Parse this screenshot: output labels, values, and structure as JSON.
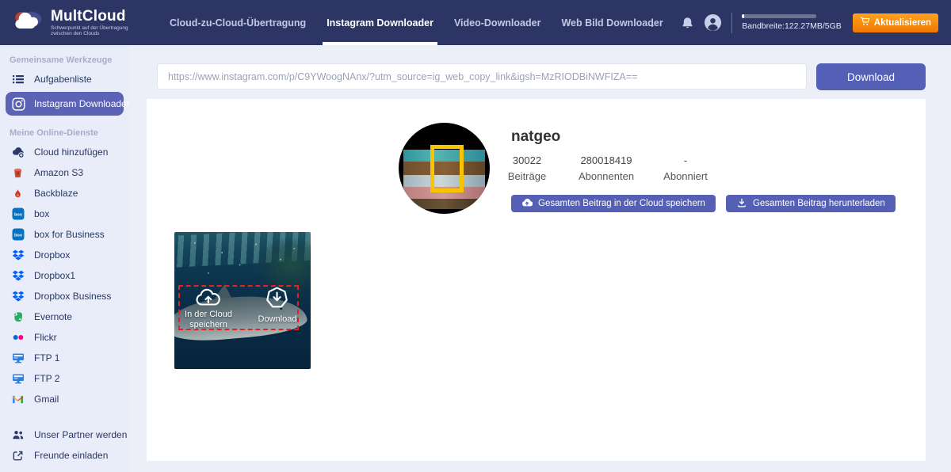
{
  "navbar": {
    "logo": {
      "title": "MultCloud",
      "tagline": "Schwerpunkt auf der Übertragung zwischen den Clouds"
    },
    "tabs": [
      {
        "label": "Cloud-zu-Cloud-Übertragung",
        "active": false
      },
      {
        "label": "Instagram Downloader",
        "active": true
      },
      {
        "label": "Video-Downloader",
        "active": false
      },
      {
        "label": "Web Bild Downloader",
        "active": false
      }
    ],
    "bandwidth": {
      "label": "Bandbreite:122.27MB/5GB",
      "percent": 3
    },
    "upgrade_button": "Aktualisieren"
  },
  "sidebar": {
    "sections": [
      {
        "label": "Gemeinsame Werkzeuge",
        "items": [
          {
            "label": "Aufgabenliste",
            "icon": "task-list-icon",
            "active": false
          },
          {
            "label": "Instagram Downloader",
            "icon": "instagram-icon",
            "active": true
          }
        ]
      },
      {
        "label": "Meine Online-Dienste",
        "items": [
          {
            "label": "Cloud hinzufügen",
            "icon": "add-cloud-icon",
            "active": false
          },
          {
            "label": "Amazon S3",
            "icon": "amazon-s3-icon",
            "active": false
          },
          {
            "label": "Backblaze",
            "icon": "backblaze-icon",
            "active": false
          },
          {
            "label": "box",
            "icon": "box-icon",
            "active": false
          },
          {
            "label": "box for Business",
            "icon": "box-icon",
            "active": false
          },
          {
            "label": "Dropbox",
            "icon": "dropbox-icon",
            "active": false
          },
          {
            "label": "Dropbox1",
            "icon": "dropbox-icon",
            "active": false
          },
          {
            "label": "Dropbox Business",
            "icon": "dropbox-icon",
            "active": false
          },
          {
            "label": "Evernote",
            "icon": "evernote-icon",
            "active": false
          },
          {
            "label": "Flickr",
            "icon": "flickr-icon",
            "active": false
          },
          {
            "label": "FTP 1",
            "icon": "ftp-icon",
            "active": false
          },
          {
            "label": "FTP 2",
            "icon": "ftp-icon",
            "active": false
          },
          {
            "label": "Gmail",
            "icon": "gmail-icon",
            "active": false
          }
        ]
      }
    ],
    "footer_items": [
      {
        "label": "Unser Partner werden",
        "icon": "partner-icon",
        "active": false
      },
      {
        "label": "Freunde einladen",
        "icon": "invite-icon",
        "active": false
      }
    ]
  },
  "downloader": {
    "url_value": "https://www.instagram.com/p/C9YWoogNAnx/?utm_source=ig_web_copy_link&igsh=MzRIODBiNWFIZA==",
    "download_button": "Download"
  },
  "profile": {
    "username": "natgeo",
    "stats": [
      {
        "value": "30022",
        "label": "Beiträge"
      },
      {
        "value": "280018419",
        "label": "Abonnenten"
      },
      {
        "value": "-",
        "label": "Abonniert"
      }
    ],
    "save_all_button": "Gesamten Beitrag in der Cloud speichern",
    "download_all_button": "Gesamten Beitrag herunterladen"
  },
  "post": {
    "save_label": "In der Cloud speichern",
    "download_label": "Download"
  },
  "colors": {
    "navbar_bg": "#2d3565",
    "sidebar_bg": "#e9edf9",
    "accent_purple": "#5a63b5",
    "button_purple": "#5560b4",
    "upgrade_orange": "#f07800",
    "selection_red": "#e8201f",
    "main_bg": "#edeff8"
  }
}
